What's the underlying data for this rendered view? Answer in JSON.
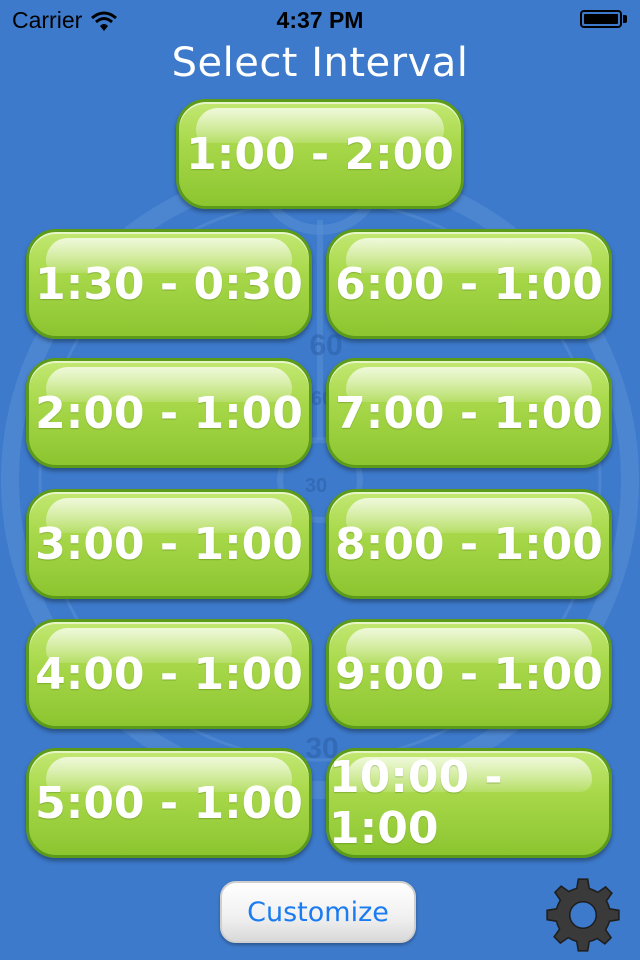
{
  "status_bar": {
    "carrier": "Carrier",
    "time": "4:37 PM"
  },
  "title": "Select Interval",
  "intervals": [
    "1:00 - 2:00",
    "1:30 - 0:30",
    "6:00 - 1:00",
    "2:00 - 1:00",
    "7:00 - 1:00",
    "3:00 - 1:00",
    "8:00 - 1:00",
    "4:00 - 1:00",
    "9:00 - 1:00",
    "5:00 - 1:00",
    "10:00 - 1:00"
  ],
  "customize_label": "Customize",
  "dial_numbers": [
    "60",
    "60",
    "30",
    "30"
  ],
  "icons": {
    "wifi": "wifi-icon",
    "battery": "battery-icon",
    "settings": "gear-icon"
  },
  "colors": {
    "background": "#3d7acb",
    "button_green": "#a8d84a",
    "button_border": "#5c9a1a",
    "customize_text": "#1a7cf0"
  }
}
